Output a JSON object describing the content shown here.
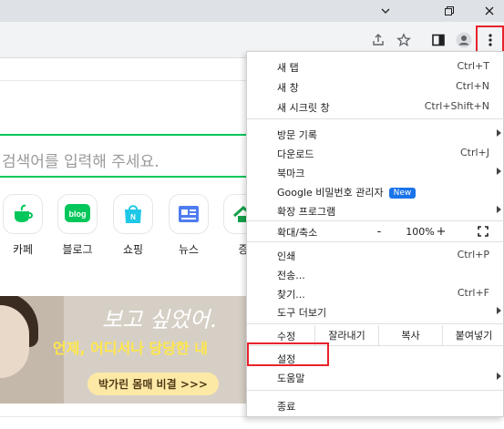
{
  "colors": {
    "accent_red": "#e8232b",
    "naver_green": "#03c75a",
    "new_badge": "#1a73e8",
    "banner_text_yellow": "#ffe74a"
  },
  "window": {
    "minimize_icon": "minimize-icon",
    "restore_icon": "restore-icon",
    "close_icon": "close-icon"
  },
  "toolbar": {
    "icons": [
      "share-icon",
      "star-icon",
      "side-panel-icon",
      "profile-icon",
      "more-vert-icon"
    ]
  },
  "page": {
    "search_placeholder": "검색어를 입력해 주세요.",
    "services": [
      {
        "label": "카페",
        "icon": "cafe-icon",
        "color": "#03c75a"
      },
      {
        "label": "블로그",
        "icon": "blog-icon",
        "color": "#03c75a"
      },
      {
        "label": "쇼핑",
        "icon": "shopping-icon",
        "color": "#1ec8e6"
      },
      {
        "label": "뉴스",
        "icon": "news-icon",
        "color": "#4f7cf0"
      },
      {
        "label": "증",
        "icon": "stock-icon",
        "color": "#14a04a"
      }
    ],
    "banner": {
      "script_text": "보고 싶었어.",
      "headline": "언제, 어디서나 당당한 내",
      "pill": "박가린 몸매 비결 >>>"
    }
  },
  "menu": {
    "items_top": [
      {
        "label": "새 탭",
        "shortcut": "Ctrl+T"
      },
      {
        "label": "새 창",
        "shortcut": "Ctrl+N"
      },
      {
        "label": "새 시크릿 창",
        "shortcut": "Ctrl+Shift+N"
      }
    ],
    "items_mid": [
      {
        "label": "방문 기록",
        "shortcut": "",
        "submenu": true
      },
      {
        "label": "다운로드",
        "shortcut": "Ctrl+J",
        "submenu": false
      },
      {
        "label": "북마크",
        "shortcut": "",
        "submenu": true
      },
      {
        "label": "Google 비밀번호 관리자",
        "shortcut": "",
        "submenu": false,
        "badge": "New"
      },
      {
        "label": "확장 프로그램",
        "shortcut": "",
        "submenu": true
      }
    ],
    "zoom": {
      "label": "확대/축소",
      "minus": "-",
      "value": "100%",
      "plus": "+",
      "fullscreen_icon": "fullscreen-icon"
    },
    "items_tools": [
      {
        "label": "인쇄",
        "shortcut": "Ctrl+P",
        "submenu": false
      },
      {
        "label": "전송...",
        "shortcut": "",
        "submenu": false
      },
      {
        "label": "찾기...",
        "shortcut": "Ctrl+F",
        "submenu": false
      },
      {
        "label": "도구 더보기",
        "shortcut": "",
        "submenu": true
      }
    ],
    "edit": {
      "label": "수정",
      "cut": "잘라내기",
      "copy": "복사",
      "paste": "붙여넣기"
    },
    "settings": {
      "label": "설정"
    },
    "help": {
      "label": "도움말",
      "submenu": true
    },
    "exit": {
      "label": "종료"
    }
  }
}
